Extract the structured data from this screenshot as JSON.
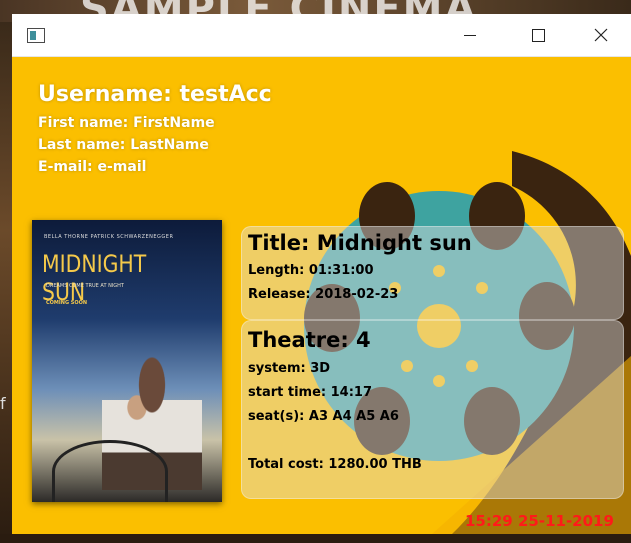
{
  "window": {
    "app_icon": "app-window-icon",
    "background_color": "#fbbf00",
    "accent_teal": "#3ea3a0"
  },
  "background_app": {
    "banner_text": "SAMPLE CINEMA",
    "side_letter": "f"
  },
  "user": {
    "username": "Username: testAcc",
    "first_name": "First name: FirstName",
    "last_name": "Last name: LastName",
    "email": "E-mail: e-mail"
  },
  "poster": {
    "credits": "BELLA THORNE   PATRICK SCHWARZENEGGER",
    "title": "MIDNIGHT SUN",
    "tagline": "DREAMS COME TRUE AT NIGHT",
    "coming": "COMING SOON"
  },
  "movie": {
    "title": "Title: Midnight sun",
    "length": "Length: 01:31:00",
    "release": "Release: 2018-02-23"
  },
  "showing": {
    "theatre": "Theatre: 4",
    "system": "system: 3D",
    "start_time": "start time: 14:17",
    "seats": "seat(s): A3 A4 A5 A6",
    "total_cost": "Total cost: 1280.00 THB"
  },
  "clock": {
    "datetime": "15:29 25-11-2019",
    "color": "#ff1a1a"
  }
}
